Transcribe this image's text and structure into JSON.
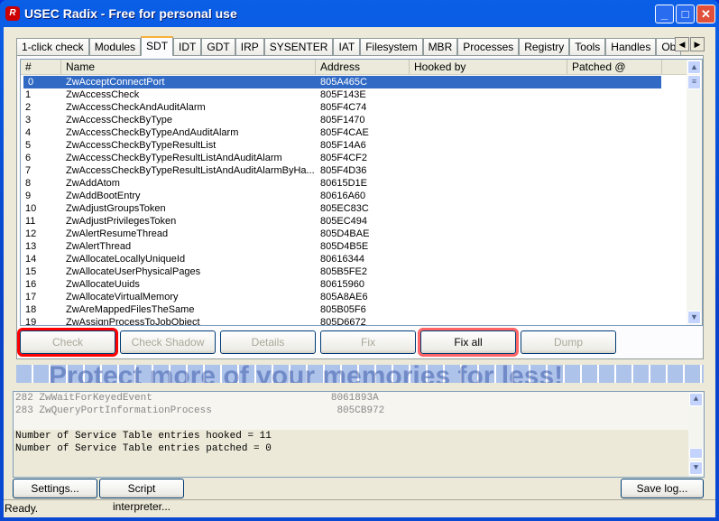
{
  "window": {
    "title": "USEC Radix - Free for personal use",
    "icon": "R"
  },
  "tabs": [
    "1-click check",
    "Modules",
    "SDT",
    "IDT",
    "GDT",
    "IRP",
    "SYSENTER",
    "IAT",
    "Filesystem",
    "MBR",
    "Processes",
    "Registry",
    "Tools",
    "Handles",
    "Ob"
  ],
  "active_tab": "SDT",
  "columns": [
    "#",
    "Name",
    "Address",
    "Hooked by",
    "Patched @"
  ],
  "rows": [
    [
      "0",
      "ZwAcceptConnectPort",
      "805A465C"
    ],
    [
      "1",
      "ZwAccessCheck",
      "805F143E"
    ],
    [
      "2",
      "ZwAccessCheckAndAuditAlarm",
      "805F4C74"
    ],
    [
      "3",
      "ZwAccessCheckByType",
      "805F1470"
    ],
    [
      "4",
      "ZwAccessCheckByTypeAndAuditAlarm",
      "805F4CAE"
    ],
    [
      "5",
      "ZwAccessCheckByTypeResultList",
      "805F14A6"
    ],
    [
      "6",
      "ZwAccessCheckByTypeResultListAndAuditAlarm",
      "805F4CF2"
    ],
    [
      "7",
      "ZwAccessCheckByTypeResultListAndAuditAlarmByHa...",
      "805F4D36"
    ],
    [
      "8",
      "ZwAddAtom",
      "80615D1E"
    ],
    [
      "9",
      "ZwAddBootEntry",
      "80616A60"
    ],
    [
      "10",
      "ZwAdjustGroupsToken",
      "805EC83C"
    ],
    [
      "11",
      "ZwAdjustPrivilegesToken",
      "805EC494"
    ],
    [
      "12",
      "ZwAlertResumeThread",
      "805D4BAE"
    ],
    [
      "13",
      "ZwAlertThread",
      "805D4B5E"
    ],
    [
      "14",
      "ZwAllocateLocallyUniqueId",
      "80616344"
    ],
    [
      "15",
      "ZwAllocateUserPhysicalPages",
      "805B5FE2"
    ],
    [
      "16",
      "ZwAllocateUuids",
      "80615960"
    ],
    [
      "17",
      "ZwAllocateVirtualMemory",
      "805A8AE6"
    ],
    [
      "18",
      "ZwAreMappedFilesTheSame",
      "805B05F6"
    ],
    [
      "19",
      "ZwAssignProcessToJobObject",
      "805D6672"
    ]
  ],
  "buttons": {
    "check": "Check",
    "check_shadow": "Check Shadow",
    "details": "Details",
    "fix": "Fix",
    "fix_all": "Fix all",
    "dump": "Dump"
  },
  "watermark": "Protect more of your memories for less!",
  "log": {
    "lines": [
      "282 ZwWaitForKeyedEvent                              8061893A",
      "283 ZwQueryPortInformationProcess                     805CB972",
      "",
      "Number of Service Table entries hooked = 11",
      "Number of Service Table entries patched = 0"
    ]
  },
  "bottom": {
    "settings": "Settings...",
    "script": "Script interpreter...",
    "save_log": "Save log..."
  },
  "status": "Ready.",
  "colors": {
    "selection": "#316ac5",
    "highlight": "#ff0000"
  }
}
